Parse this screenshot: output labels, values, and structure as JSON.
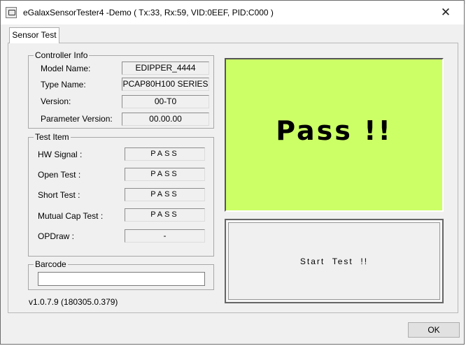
{
  "window": {
    "title": "eGalaxSensorTester4 -Demo ( Tx:33, Rx:59, VID:0EEF, PID:C000 )",
    "close_glyph": "✕"
  },
  "tabs": [
    {
      "label": "Sensor Test",
      "active": true
    }
  ],
  "controller_info": {
    "label": "Controller Info",
    "rows": [
      {
        "label": "Model Name:",
        "value": "EDIPPER_4444"
      },
      {
        "label": "Type Name:",
        "value": "PCAP80H100 SERIES"
      },
      {
        "label": "Version:",
        "value": "00-T0"
      },
      {
        "label": "Parameter Version:",
        "value": "00.00.00"
      }
    ]
  },
  "test_item": {
    "label": "Test Item",
    "rows": [
      {
        "label": "HW Signal :",
        "value": "PASS"
      },
      {
        "label": "Open Test :",
        "value": "PASS"
      },
      {
        "label": "Short Test :",
        "value": "PASS"
      },
      {
        "label": "Mutual Cap Test :",
        "value": "PASS"
      },
      {
        "label": "OPDraw :",
        "value": "-"
      }
    ]
  },
  "barcode": {
    "label": "Barcode",
    "value": ""
  },
  "version_text": "v1.0.7.9 (180305.0.379)",
  "result": {
    "text": "Pass !!",
    "color": "#ccff66"
  },
  "start_button": {
    "label": "Start  Test  !!"
  },
  "ok_button": {
    "label": "OK"
  }
}
